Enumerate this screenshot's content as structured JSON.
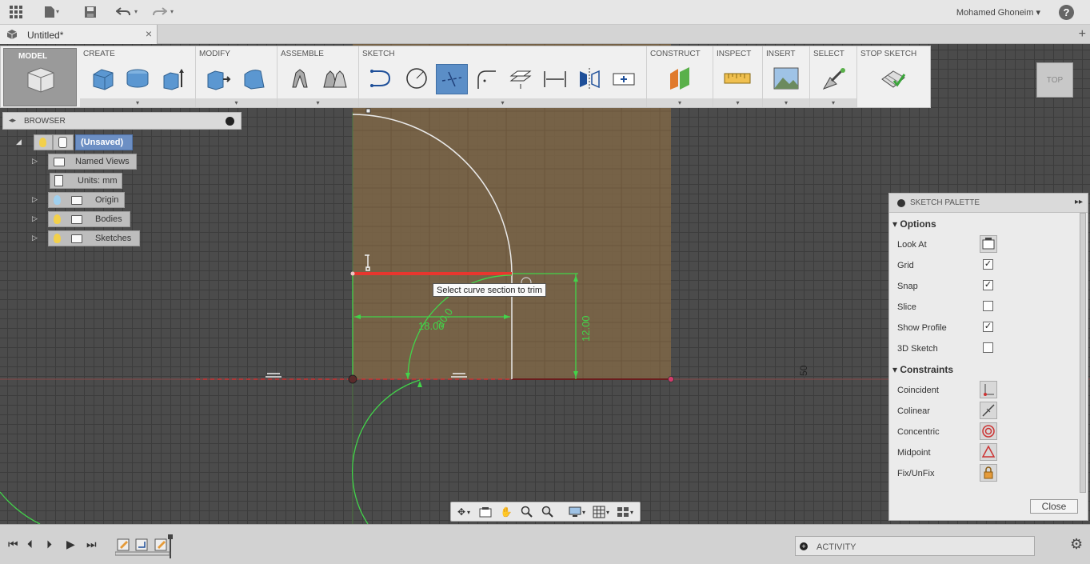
{
  "topbar": {
    "user": "Mohamed Ghoneim ▾",
    "help": "?"
  },
  "document": {
    "tab_title": "Untitled*",
    "close": "×",
    "new_tab": "+"
  },
  "toolbar": {
    "mode": "MODEL",
    "groups": {
      "create": "CREATE",
      "modify": "MODIFY",
      "assemble": "ASSEMBLE",
      "sketch": "SKETCH",
      "construct": "CONSTRUCT",
      "inspect": "INSPECT",
      "insert": "INSERT",
      "select": "SELECT",
      "stop_sketch": "STOP SKETCH"
    },
    "dropdown": "▾"
  },
  "browser": {
    "title": "BROWSER",
    "nodes": {
      "root": "(Unsaved)",
      "named_views": "Named Views",
      "units": "Units: mm",
      "origin": "Origin",
      "bodies": "Bodies",
      "sketches": "Sketches"
    }
  },
  "viewcube": {
    "face": "TOP"
  },
  "sketch": {
    "tooltip": "Select curve section to trim",
    "dim_width": "18.00",
    "dim_height": "12.00",
    "dim_radius": "20.0",
    "axis_label": "50"
  },
  "palette": {
    "title": "SKETCH PALETTE",
    "options_header": "Options",
    "options": [
      {
        "label": "Look At"
      },
      {
        "label": "Grid",
        "checked": "✓"
      },
      {
        "label": "Snap",
        "checked": "✓"
      },
      {
        "label": "Slice",
        "checked": ""
      },
      {
        "label": "Show Profile",
        "checked": "✓"
      },
      {
        "label": "3D Sketch",
        "checked": ""
      }
    ],
    "constraints_header": "Constraints",
    "constraints": [
      "Coincident",
      "Colinear",
      "Concentric",
      "Midpoint",
      "Fix/UnFix"
    ],
    "close": "Close"
  },
  "activity": {
    "label": "ACTIVITY",
    "plus": "+"
  },
  "colors": {
    "accent": "#5b8ec7",
    "sketch_fill": "#7a6447",
    "trim_line": "#e8362e",
    "dimension": "#42d44a"
  }
}
